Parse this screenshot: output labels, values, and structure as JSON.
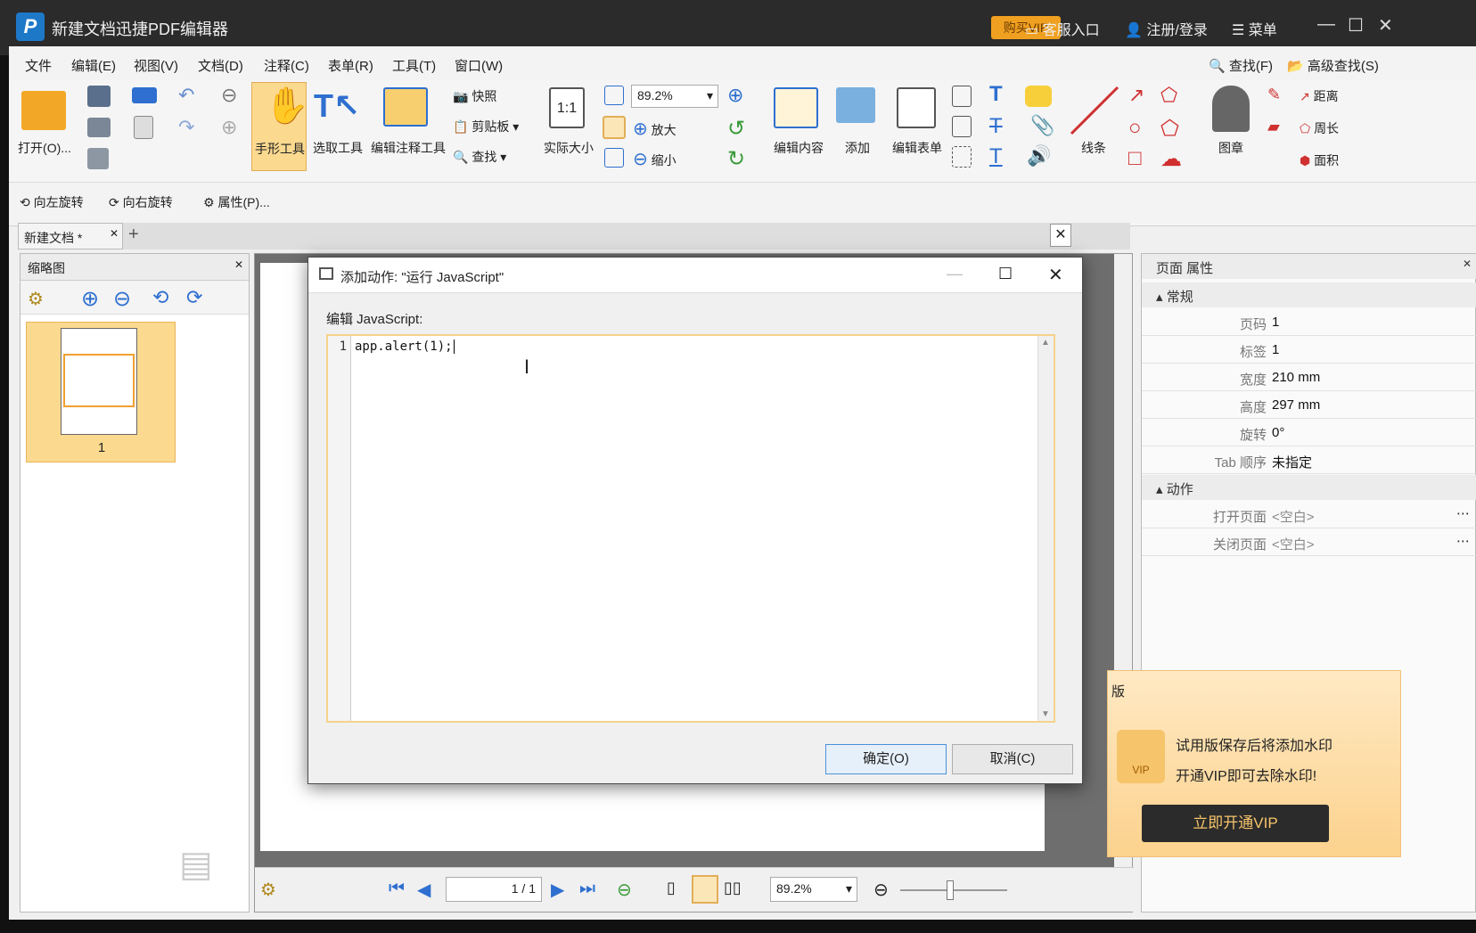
{
  "window": {
    "title": "新建文档迅捷PDF编辑器",
    "vip_button": "购买VIP",
    "service": "客服入口",
    "login": "注册/登录",
    "menu": "菜单"
  },
  "menubar": [
    "文件",
    "编辑(E)",
    "视图(V)",
    "文档(D)",
    "注释(C)",
    "表单(R)",
    "工具(T)",
    "窗口(W)"
  ],
  "search": {
    "find": "查找(F)",
    "advanced": "高级查找(S)"
  },
  "ribbon": {
    "open": "打开(O)...",
    "hand": "手形工具",
    "select": "选取工具",
    "edit_annot": "编辑注释工具",
    "snapshot": "快照",
    "clipboard": "剪贴板",
    "find": "查找",
    "actual_size": "实际大小",
    "zoom_value": "89.2%",
    "zoom_in": "放大",
    "zoom_out": "缩小",
    "edit_content": "编辑内容",
    "add": "添加",
    "edit_form": "编辑表单",
    "line": "线条",
    "stamp": "图章",
    "distance": "距离",
    "perimeter": "周长",
    "area": "面积"
  },
  "quickbar": {
    "rotate_left": "向左旋转",
    "rotate_right": "向右旋转",
    "properties": "属性(P)..."
  },
  "tab": {
    "name": "新建文档 *"
  },
  "thumbs": {
    "title": "缩略图",
    "page_label": "1"
  },
  "props": {
    "header": "页面 属性",
    "section_general": "常规",
    "rows": [
      {
        "k": "页码",
        "v": "1"
      },
      {
        "k": "标签",
        "v": "1"
      },
      {
        "k": "宽度",
        "v": "210 mm"
      },
      {
        "k": "高度",
        "v": "297 mm"
      },
      {
        "k": "旋转",
        "v": "0°"
      },
      {
        "k": "Tab 顺序",
        "v": "未指定"
      }
    ],
    "section_action": "动作",
    "actions": [
      {
        "k": "打开页面",
        "v": "<空白>"
      },
      {
        "k": "关闭页面",
        "v": "<空白>"
      }
    ]
  },
  "vip_ad": {
    "heading": "版",
    "line1": "试用版保存后将添加水印",
    "line2": "开通VIP即可去除水印!",
    "button": "立即开通VIP",
    "badge": "VIP"
  },
  "dialog": {
    "title": "添加动作: \"运行 JavaScript\"",
    "label": "编辑 JavaScript:",
    "line_no": "1",
    "code": "app.alert(1);",
    "ok": "确定(O)",
    "cancel": "取消(C)"
  },
  "bottombar": {
    "page": "1 / 1",
    "zoom": "89.2%"
  }
}
